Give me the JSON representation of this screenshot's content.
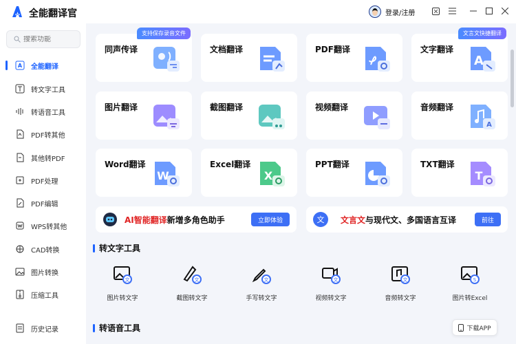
{
  "app": {
    "title": "全能翻译官",
    "user_label": "登录/注册"
  },
  "search": {
    "placeholder": "搜索功能"
  },
  "sidebar": {
    "items": [
      {
        "label": "全能翻译",
        "icon": "translate-icon",
        "active": true
      },
      {
        "label": "转文字工具",
        "icon": "text-t-icon"
      },
      {
        "label": "转语音工具",
        "icon": "voice-icon"
      },
      {
        "label": "PDF转其他",
        "icon": "pdf-export-icon"
      },
      {
        "label": "其他转PDF",
        "icon": "pdf-import-icon"
      },
      {
        "label": "PDF处理",
        "icon": "pdf-process-icon"
      },
      {
        "label": "PDF编辑",
        "icon": "pdf-edit-icon"
      },
      {
        "label": "WPS转其他",
        "icon": "wps-icon"
      },
      {
        "label": "CAD转换",
        "icon": "cad-icon"
      },
      {
        "label": "图片转换",
        "icon": "image-icon"
      },
      {
        "label": "压缩工具",
        "icon": "compress-icon"
      }
    ],
    "history_label": "历史记录"
  },
  "cards": [
    {
      "label": "同声传译",
      "icon": "simultaneous-interpretation-icon",
      "badge": "支持保存录音文件"
    },
    {
      "label": "文档翻译",
      "icon": "document-translate-icon"
    },
    {
      "label": "PDF翻译",
      "icon": "pdf-translate-icon"
    },
    {
      "label": "文字翻译",
      "icon": "text-translate-icon",
      "badge": "文言文快捷翻译"
    },
    {
      "label": "图片翻译",
      "icon": "image-translate-icon"
    },
    {
      "label": "截图翻译",
      "icon": "screenshot-translate-icon"
    },
    {
      "label": "视频翻译",
      "icon": "video-translate-icon"
    },
    {
      "label": "音频翻译",
      "icon": "audio-translate-icon"
    },
    {
      "label": "Word翻译",
      "icon": "word-translate-icon"
    },
    {
      "label": "Excel翻译",
      "icon": "excel-translate-icon"
    },
    {
      "label": "PPT翻译",
      "icon": "ppt-translate-icon"
    },
    {
      "label": "TXT翻译",
      "icon": "txt-translate-icon"
    }
  ],
  "banners": [
    {
      "highlight": "AI智能翻译",
      "text": "新增多角色助手",
      "button": "立即体验",
      "icon": "robot-icon"
    },
    {
      "highlight": "文言文",
      "text": "与现代文、多国语言互译",
      "button": "前往",
      "icon": "classical-text-icon"
    }
  ],
  "sections": {
    "to_text": "转文字工具",
    "to_voice": "转语音工具"
  },
  "tools": [
    {
      "label": "图片转文字",
      "icon": "image-to-text-icon"
    },
    {
      "label": "截图转文字",
      "icon": "screenshot-to-text-icon"
    },
    {
      "label": "手写转文字",
      "icon": "handwriting-to-text-icon"
    },
    {
      "label": "视频转文字",
      "icon": "video-to-text-icon"
    },
    {
      "label": "音频转文字",
      "icon": "audio-to-text-icon"
    },
    {
      "label": "图片转Excel",
      "icon": "image-to-excel-icon"
    }
  ],
  "download_app": "下载APP",
  "colors": {
    "accent": "#1d63ff",
    "highlight_red": "#e02424",
    "background": "#f3f5fa"
  }
}
